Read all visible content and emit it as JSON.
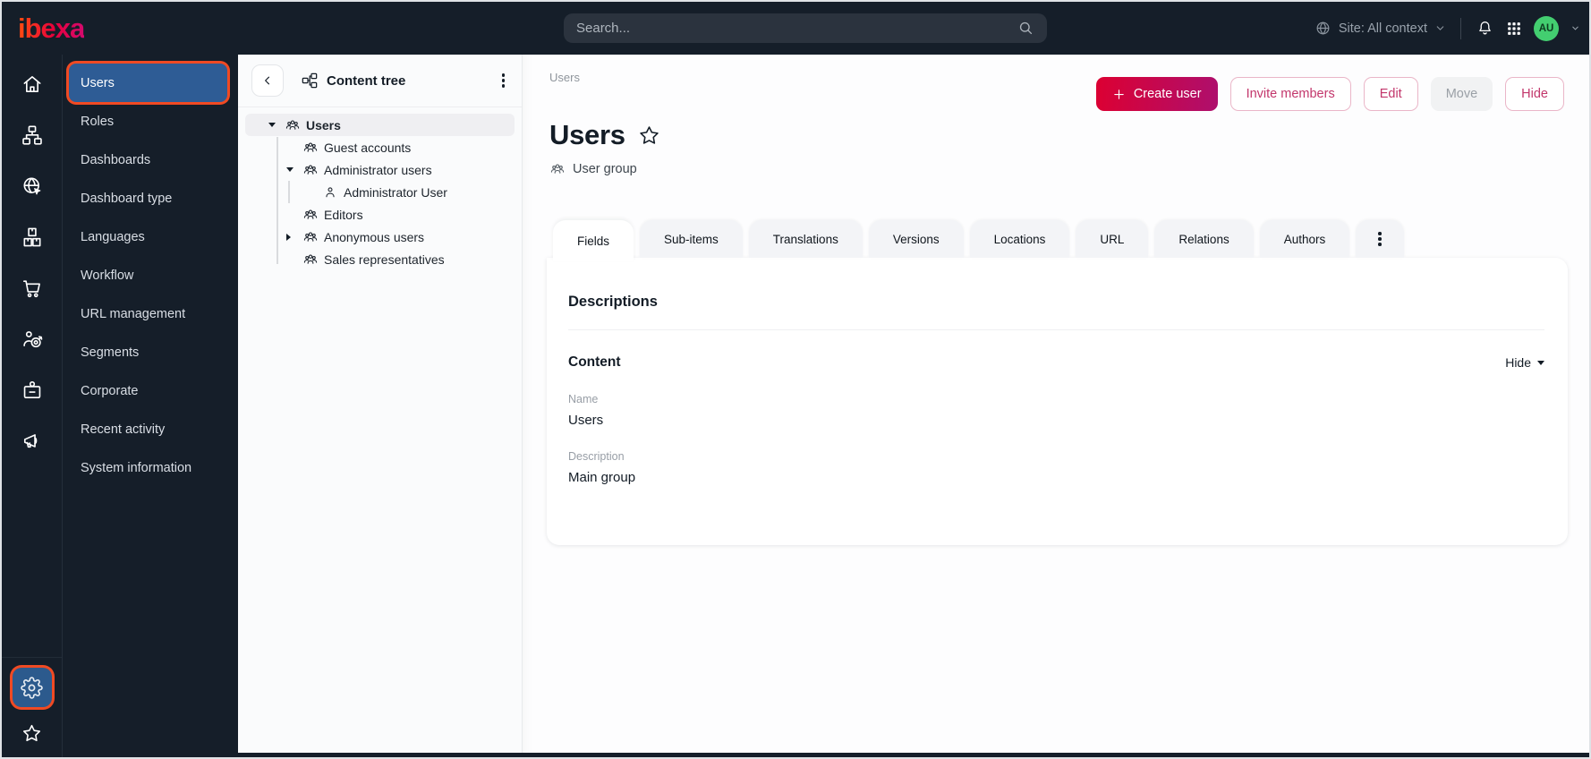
{
  "topbar": {
    "logo_text": "ibexa",
    "search_placeholder": "Search...",
    "site_selector_label": "Site: All context",
    "avatar_initials": "AU",
    "icons": [
      "search-icon",
      "site-globe-icon",
      "chevron-down-icon",
      "notifications-bell-icon",
      "app-grid-icon"
    ]
  },
  "rail": {
    "items": [
      {
        "icon": "home-icon"
      },
      {
        "icon": "content-sitemap-icon"
      },
      {
        "icon": "site-cursor-globe-icon"
      },
      {
        "icon": "products-boxes-icon"
      },
      {
        "icon": "commerce-cart-icon"
      },
      {
        "icon": "customer-target-icon"
      },
      {
        "icon": "corporate-badge-icon"
      },
      {
        "icon": "marketing-megaphone-icon"
      }
    ],
    "bottom_items": [
      {
        "icon": "settings-gear-icon",
        "active": true,
        "highlighted": true
      },
      {
        "icon": "bookmarks-star-icon"
      }
    ],
    "highlight_color": "#f04a23"
  },
  "sidebar": {
    "items": [
      {
        "label": "Users",
        "active": true
      },
      {
        "label": "Roles"
      },
      {
        "label": "Dashboards"
      },
      {
        "label": "Dashboard type"
      },
      {
        "label": "Languages"
      },
      {
        "label": "Workflow"
      },
      {
        "label": "URL management"
      },
      {
        "label": "Segments"
      },
      {
        "label": "Corporate"
      },
      {
        "label": "Recent activity"
      },
      {
        "label": "System information"
      }
    ]
  },
  "content_tree": {
    "title": "Content tree",
    "items": [
      {
        "label": "Users",
        "depth": 0,
        "icon": "user-group-icon",
        "expander": "open",
        "selected": true
      },
      {
        "label": "Guest accounts",
        "depth": 1,
        "icon": "user-group-icon",
        "expander": "none"
      },
      {
        "label": "Administrator users",
        "depth": 1,
        "icon": "user-group-icon",
        "expander": "open"
      },
      {
        "label": "Administrator User",
        "depth": 2,
        "icon": "user-icon",
        "expander": "none"
      },
      {
        "label": "Editors",
        "depth": 1,
        "icon": "user-group-icon",
        "expander": "none"
      },
      {
        "label": "Anonymous users",
        "depth": 1,
        "icon": "user-group-icon",
        "expander": "closed"
      },
      {
        "label": "Sales representatives",
        "depth": 1,
        "icon": "user-group-icon",
        "expander": "none"
      }
    ]
  },
  "main": {
    "breadcrumb": "Users",
    "title": "Users",
    "content_type": "User group",
    "actions": {
      "create": "Create user",
      "invite": "Invite members",
      "edit": "Edit",
      "move": "Move",
      "hide": "Hide",
      "move_disabled": true
    },
    "tabs": [
      {
        "label": "Fields",
        "active": true
      },
      {
        "label": "Sub-items"
      },
      {
        "label": "Translations"
      },
      {
        "label": "Versions"
      },
      {
        "label": "Locations"
      },
      {
        "label": "URL"
      },
      {
        "label": "Relations"
      },
      {
        "label": "Authors"
      }
    ],
    "card": {
      "heading": "Descriptions",
      "group_name": "Content",
      "collapse_label": "Hide",
      "fields": [
        {
          "label": "Name",
          "value": "Users"
        },
        {
          "label": "Description",
          "value": "Main group"
        }
      ]
    }
  },
  "colors": {
    "topbar_bg": "#151e29",
    "active_item_blue": "#2e5c95",
    "annotation_orange": "#f04a23",
    "primary_gradient": [
      "#dc0032",
      "#ae0f6d"
    ],
    "outline_button_pink": "#c2366b",
    "avatar_green": "#43ce70"
  }
}
